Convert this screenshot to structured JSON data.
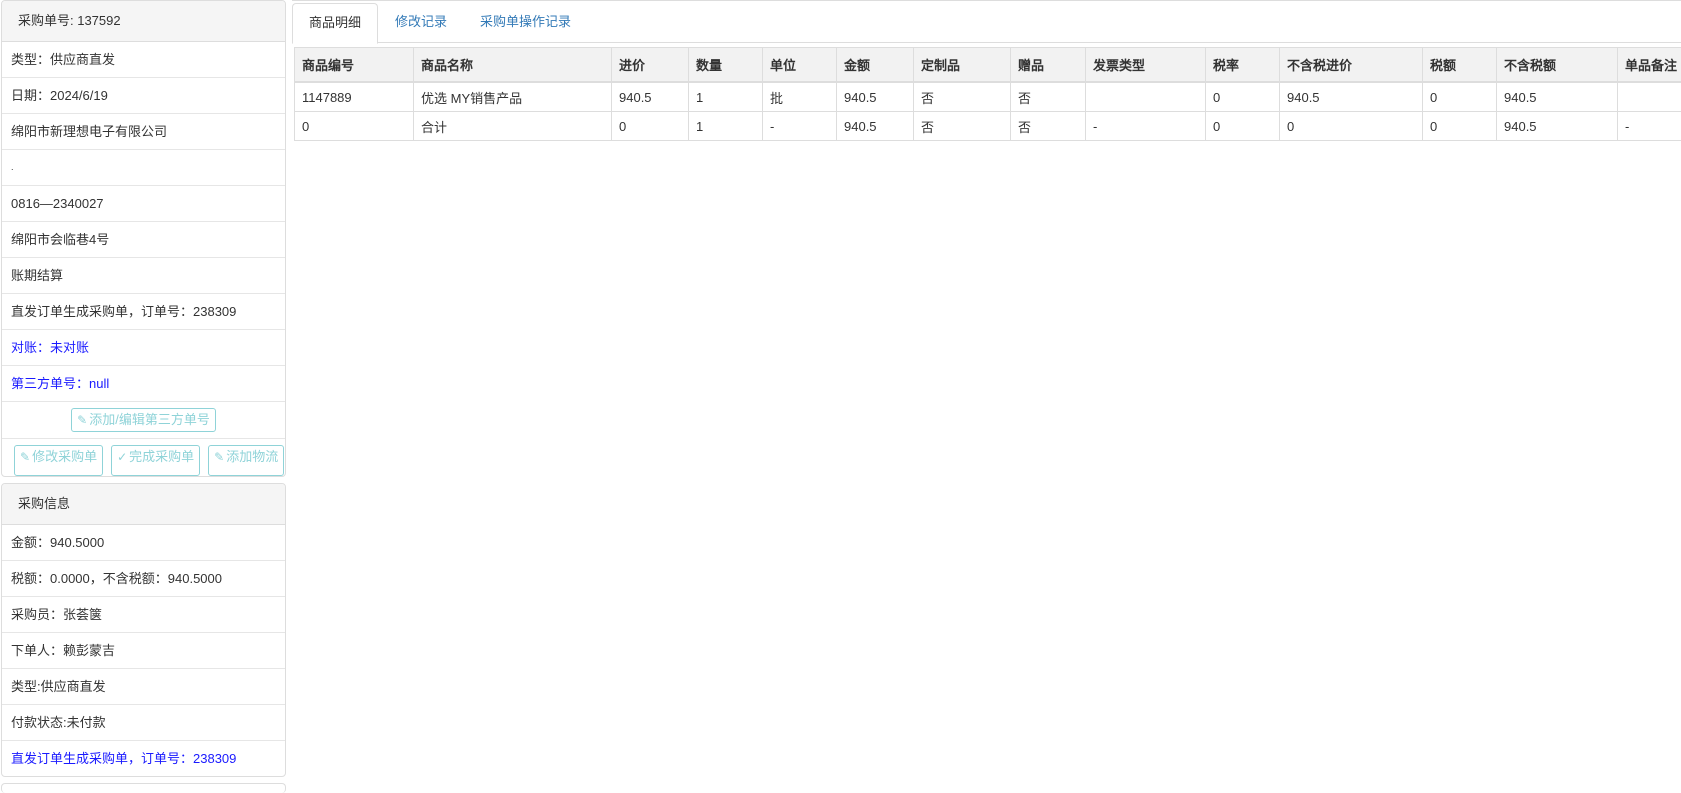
{
  "order_panel": {
    "header": "采购单号: 137592",
    "rows": [
      "类型：供应商直发",
      "日期：2024/6/19",
      "绵阳市新理想电子有限公司",
      ".",
      "0816—2340027",
      "绵阳市会临巷4号",
      "账期结算",
      "直发订单生成采购单，订单号：238309",
      "对账：未对账",
      "第三方单号：null"
    ],
    "buttons": {
      "add_edit_third_party": "添加/编辑第三方单号",
      "modify_order": "修改采购单",
      "complete_order": "完成采购单",
      "add_logistics": "添加物流"
    }
  },
  "purchase_info": {
    "header": "采购信息",
    "rows": [
      "金额：940.5000",
      "税额：0.0000，不含税额：940.5000",
      "采购员：张荟箧",
      "下单人：赖彭蒙吉",
      "类型:供应商直发",
      "付款状态:未付款",
      "直发订单生成采购单，订单号：238309"
    ]
  },
  "tabs": [
    "商品明细",
    "修改记录",
    "采购单操作记录"
  ],
  "table": {
    "headers": [
      "商品编号",
      "商品名称",
      "进价",
      "数量",
      "单位",
      "金额",
      "定制品",
      "赠品",
      "发票类型",
      "税率",
      "不含税进价",
      "税额",
      "不含税额",
      "单品备注"
    ],
    "rows": [
      [
        "1147889",
        "优选 MY销售产品",
        "940.5",
        "1",
        "批",
        "940.5",
        "否",
        "否",
        "",
        "0",
        "940.5",
        "0",
        "940.5",
        ""
      ],
      [
        "0",
        "合计",
        "0",
        "1",
        "-",
        "940.5",
        "否",
        "否",
        "-",
        "0",
        "0",
        "0",
        "940.5",
        "-"
      ]
    ]
  },
  "colors": {
    "link_blue": "#337ab7",
    "status_blue": "#1a1aff",
    "button_teal": "#8fd3d8"
  },
  "icons": {
    "edit": "edit-icon",
    "check_circle": "check-circle-icon"
  }
}
